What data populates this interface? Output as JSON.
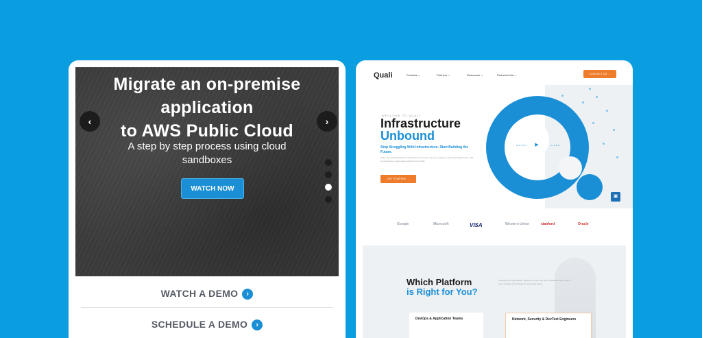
{
  "left_card": {
    "hero": {
      "title_line1": "Migrate an on-premise",
      "title_line2": "application",
      "title_line3": "to AWS Public Cloud",
      "subtitle_line1": "A step by step process using cloud",
      "subtitle_line2": "sandboxes",
      "watch_now_label": "WATCH NOW",
      "prev_arrow": "‹",
      "next_arrow": "›",
      "slide_count": 4,
      "active_slide": 3
    },
    "watch_demo_label": "WATCH A DEMO",
    "schedule_demo_label": "SCHEDULE A DEMO",
    "link_icon": "›"
  },
  "right_card": {
    "nav": {
      "logo": "Quali",
      "items": [
        "Products ⌄",
        "Partners ⌄",
        "Resources ⌄",
        "Partners/Jobs ⌄"
      ],
      "contact_label": "CONTACT US →"
    },
    "hero": {
      "eyebrow": "WELCOME TO QUALI",
      "title_line1": "Infrastructure",
      "title_line2": "Unbound",
      "subtitle": "Stop Struggling With Infrastructure. Start Building the Future.",
      "body": "Make your cloud footprint as cost-efficient and secure as your existing on-premises infrastructure, with comprehensive governance solutions from Quali.",
      "cta_label": "GET STARTED →",
      "play_left": "WATCH",
      "play_right": "VIDEO",
      "play_icon": "▶",
      "chat_icon": "▣"
    },
    "logos": [
      "Google",
      "Microsoft",
      "VISA",
      "Western Union",
      "stanford",
      "Oracle"
    ],
    "platform": {
      "title_line1": "Which Platform",
      "title_line2": "is Right for You?",
      "body": "Choosing the right platform depends on your role and the problems you need to solve. Explore our solutions for your team below.",
      "card1": "DevOps & Application Teams",
      "card2": "Network, Security & DevTest Engineers"
    }
  },
  "colors": {
    "background": "#0a9de0",
    "accent_blue": "#1a8fd6",
    "accent_orange": "#ee7c2a"
  }
}
